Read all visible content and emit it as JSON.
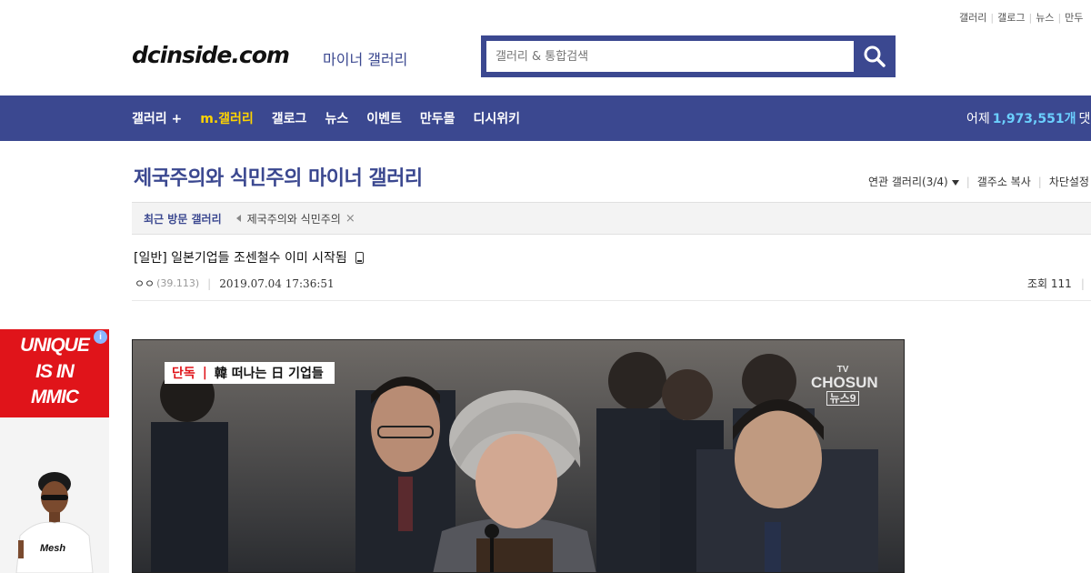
{
  "top_links": [
    "갤러리",
    "갤로그",
    "뉴스",
    "만두"
  ],
  "header": {
    "logo": "dcinside.com",
    "logo_sub": "마이너 갤러리",
    "search_placeholder": "갤러리 & 통합검색"
  },
  "nav": {
    "items": [
      "갤러리 +",
      "m.갤러리",
      "갤로그",
      "뉴스",
      "이벤트",
      "만두몰",
      "디시위키"
    ],
    "stat_prefix": "어제",
    "stat_number": "1,973,551개",
    "stat_suffix": "댓글"
  },
  "gallery": {
    "title": "제국주의와 식민주의 마이너 갤러리",
    "related": "연관 갤러리(3/4)",
    "copy_address": "갤주소 복사",
    "block_settings": "차단설정"
  },
  "recent": {
    "label": "최근 방문 갤러리",
    "items": [
      "제국주의와 식민주의"
    ],
    "remove_glyph": "×"
  },
  "post": {
    "title": "[일반] 일본기업들 조센철수 이미 시작됨",
    "author": "ㅇㅇ",
    "ip": "(39.113)",
    "date": "2019.07.04 17:36:51",
    "views_label": "조회 111"
  },
  "ad": {
    "line1": "UNIQUE",
    "line2": "IS IN",
    "line3": "MMIC",
    "info": "i"
  },
  "news_image": {
    "caption_tag": "단독",
    "caption_bar": "|",
    "caption_text": "韓 떠나는 日 기업들",
    "tv_line1": "TV",
    "tv_line2": "CHOSUN",
    "tv_line3": "뉴스9"
  },
  "colors": {
    "brand_blue": "#3b4890",
    "highlight_yellow": "#ffd400",
    "stat_blue": "#6bd0ff",
    "ad_red": "#e0141a"
  }
}
